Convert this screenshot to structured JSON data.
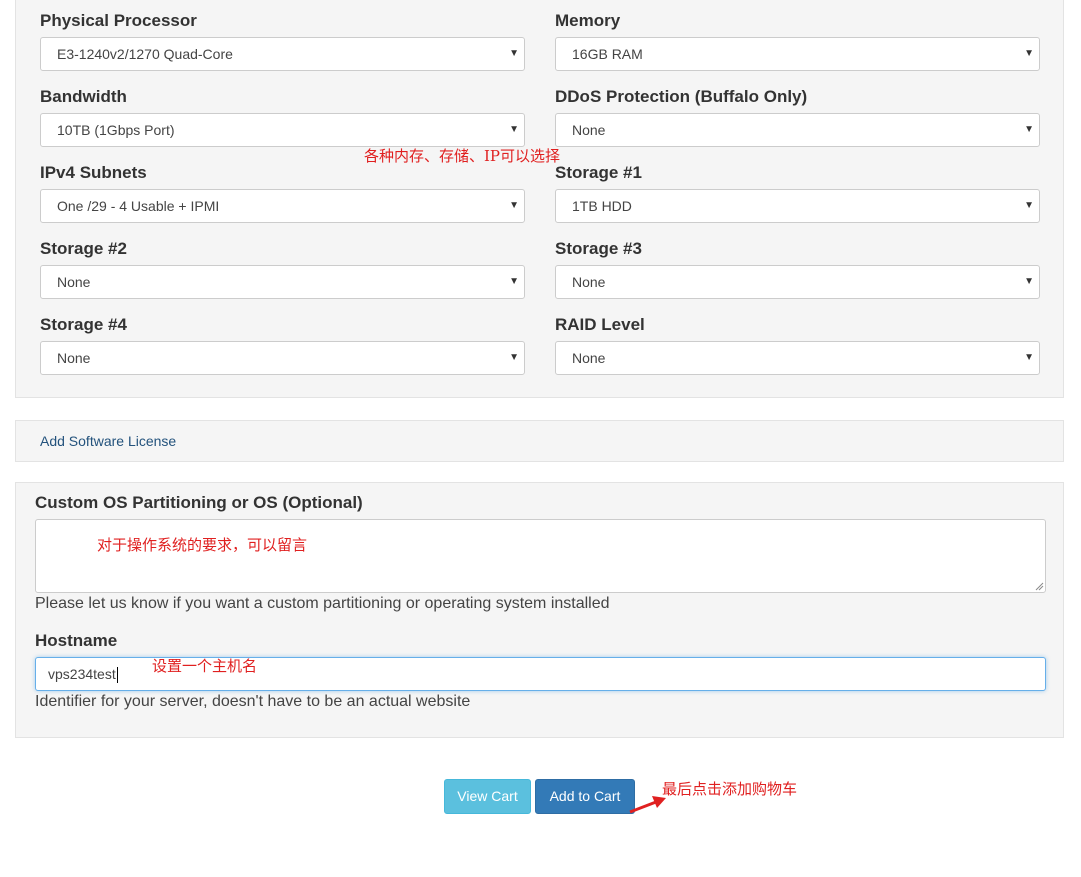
{
  "config": {
    "processor": {
      "label": "Physical Processor",
      "value": "E3-1240v2/1270 Quad-Core"
    },
    "memory": {
      "label": "Memory",
      "value": "16GB RAM"
    },
    "bandwidth": {
      "label": "Bandwidth",
      "value": "10TB (1Gbps Port)"
    },
    "ddos": {
      "label": "DDoS Protection (Buffalo Only)",
      "value": "None"
    },
    "ipv4": {
      "label": "IPv4 Subnets",
      "value": "One /29 - 4 Usable + IPMI"
    },
    "storage1": {
      "label": "Storage #1",
      "value": "1TB HDD"
    },
    "storage2": {
      "label": "Storage #2",
      "value": "None"
    },
    "storage3": {
      "label": "Storage #3",
      "value": "None"
    },
    "storage4": {
      "label": "Storage #4",
      "value": "None"
    },
    "raid": {
      "label": "RAID Level",
      "value": "None"
    },
    "dropdown_icon": "caret-down-icon"
  },
  "license": {
    "link_text": "Add Software License"
  },
  "custom_os": {
    "label": "Custom OS Partitioning or OS (Optional)",
    "value": "",
    "help": "Please let us know if you want a custom partitioning or operating system installed"
  },
  "hostname": {
    "label": "Hostname",
    "value": "vps234test",
    "help": "Identifier for your server, doesn't have to be an actual website"
  },
  "buttons": {
    "view_cart": "View Cart",
    "add_to_cart": "Add to Cart"
  },
  "annotations": {
    "options_note": "各种内存、存储、IP可以选择",
    "os_note": "对于操作系统的要求，可以留言",
    "hostname_note": "设置一个主机名",
    "cart_note": "最后点击添加购物车"
  },
  "colors": {
    "annotation": "#e02020",
    "view_cart_bg": "#5bc0de",
    "add_to_cart_bg": "#337ab7",
    "link": "#23527c"
  }
}
